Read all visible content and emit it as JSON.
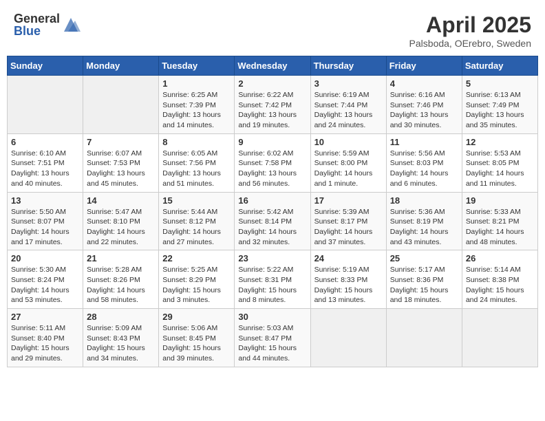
{
  "header": {
    "logo_general": "General",
    "logo_blue": "Blue",
    "month_title": "April 2025",
    "location": "Palsboda, OErebro, Sweden"
  },
  "days_of_week": [
    "Sunday",
    "Monday",
    "Tuesday",
    "Wednesday",
    "Thursday",
    "Friday",
    "Saturday"
  ],
  "weeks": [
    [
      {
        "day": "",
        "content": ""
      },
      {
        "day": "",
        "content": ""
      },
      {
        "day": "1",
        "content": "Sunrise: 6:25 AM\nSunset: 7:39 PM\nDaylight: 13 hours\nand 14 minutes."
      },
      {
        "day": "2",
        "content": "Sunrise: 6:22 AM\nSunset: 7:42 PM\nDaylight: 13 hours\nand 19 minutes."
      },
      {
        "day": "3",
        "content": "Sunrise: 6:19 AM\nSunset: 7:44 PM\nDaylight: 13 hours\nand 24 minutes."
      },
      {
        "day": "4",
        "content": "Sunrise: 6:16 AM\nSunset: 7:46 PM\nDaylight: 13 hours\nand 30 minutes."
      },
      {
        "day": "5",
        "content": "Sunrise: 6:13 AM\nSunset: 7:49 PM\nDaylight: 13 hours\nand 35 minutes."
      }
    ],
    [
      {
        "day": "6",
        "content": "Sunrise: 6:10 AM\nSunset: 7:51 PM\nDaylight: 13 hours\nand 40 minutes."
      },
      {
        "day": "7",
        "content": "Sunrise: 6:07 AM\nSunset: 7:53 PM\nDaylight: 13 hours\nand 45 minutes."
      },
      {
        "day": "8",
        "content": "Sunrise: 6:05 AM\nSunset: 7:56 PM\nDaylight: 13 hours\nand 51 minutes."
      },
      {
        "day": "9",
        "content": "Sunrise: 6:02 AM\nSunset: 7:58 PM\nDaylight: 13 hours\nand 56 minutes."
      },
      {
        "day": "10",
        "content": "Sunrise: 5:59 AM\nSunset: 8:00 PM\nDaylight: 14 hours\nand 1 minute."
      },
      {
        "day": "11",
        "content": "Sunrise: 5:56 AM\nSunset: 8:03 PM\nDaylight: 14 hours\nand 6 minutes."
      },
      {
        "day": "12",
        "content": "Sunrise: 5:53 AM\nSunset: 8:05 PM\nDaylight: 14 hours\nand 11 minutes."
      }
    ],
    [
      {
        "day": "13",
        "content": "Sunrise: 5:50 AM\nSunset: 8:07 PM\nDaylight: 14 hours\nand 17 minutes."
      },
      {
        "day": "14",
        "content": "Sunrise: 5:47 AM\nSunset: 8:10 PM\nDaylight: 14 hours\nand 22 minutes."
      },
      {
        "day": "15",
        "content": "Sunrise: 5:44 AM\nSunset: 8:12 PM\nDaylight: 14 hours\nand 27 minutes."
      },
      {
        "day": "16",
        "content": "Sunrise: 5:42 AM\nSunset: 8:14 PM\nDaylight: 14 hours\nand 32 minutes."
      },
      {
        "day": "17",
        "content": "Sunrise: 5:39 AM\nSunset: 8:17 PM\nDaylight: 14 hours\nand 37 minutes."
      },
      {
        "day": "18",
        "content": "Sunrise: 5:36 AM\nSunset: 8:19 PM\nDaylight: 14 hours\nand 43 minutes."
      },
      {
        "day": "19",
        "content": "Sunrise: 5:33 AM\nSunset: 8:21 PM\nDaylight: 14 hours\nand 48 minutes."
      }
    ],
    [
      {
        "day": "20",
        "content": "Sunrise: 5:30 AM\nSunset: 8:24 PM\nDaylight: 14 hours\nand 53 minutes."
      },
      {
        "day": "21",
        "content": "Sunrise: 5:28 AM\nSunset: 8:26 PM\nDaylight: 14 hours\nand 58 minutes."
      },
      {
        "day": "22",
        "content": "Sunrise: 5:25 AM\nSunset: 8:29 PM\nDaylight: 15 hours\nand 3 minutes."
      },
      {
        "day": "23",
        "content": "Sunrise: 5:22 AM\nSunset: 8:31 PM\nDaylight: 15 hours\nand 8 minutes."
      },
      {
        "day": "24",
        "content": "Sunrise: 5:19 AM\nSunset: 8:33 PM\nDaylight: 15 hours\nand 13 minutes."
      },
      {
        "day": "25",
        "content": "Sunrise: 5:17 AM\nSunset: 8:36 PM\nDaylight: 15 hours\nand 18 minutes."
      },
      {
        "day": "26",
        "content": "Sunrise: 5:14 AM\nSunset: 8:38 PM\nDaylight: 15 hours\nand 24 minutes."
      }
    ],
    [
      {
        "day": "27",
        "content": "Sunrise: 5:11 AM\nSunset: 8:40 PM\nDaylight: 15 hours\nand 29 minutes."
      },
      {
        "day": "28",
        "content": "Sunrise: 5:09 AM\nSunset: 8:43 PM\nDaylight: 15 hours\nand 34 minutes."
      },
      {
        "day": "29",
        "content": "Sunrise: 5:06 AM\nSunset: 8:45 PM\nDaylight: 15 hours\nand 39 minutes."
      },
      {
        "day": "30",
        "content": "Sunrise: 5:03 AM\nSunset: 8:47 PM\nDaylight: 15 hours\nand 44 minutes."
      },
      {
        "day": "",
        "content": ""
      },
      {
        "day": "",
        "content": ""
      },
      {
        "day": "",
        "content": ""
      }
    ]
  ]
}
